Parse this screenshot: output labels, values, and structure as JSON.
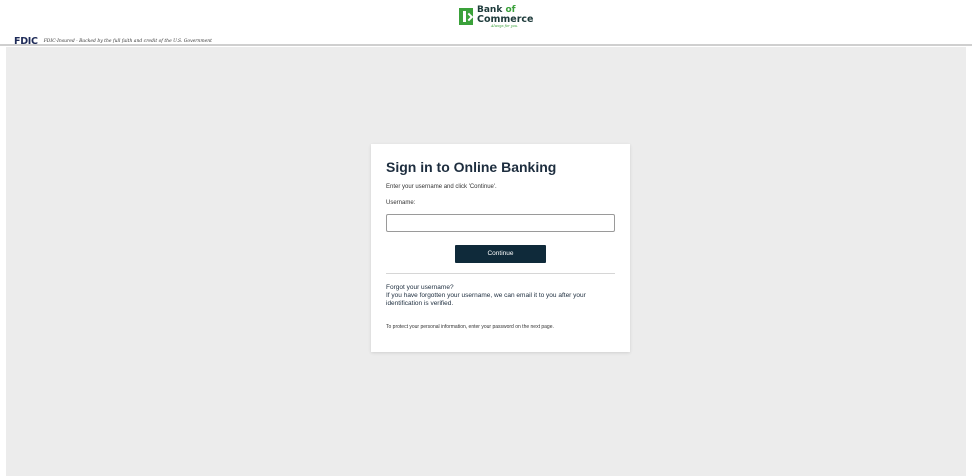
{
  "header": {
    "fdic_logo": "FDIC",
    "fdic_text": "FDIC-Insured - Backed by the full faith and credit of the U.S. Government",
    "brand_line1_a": "Bank",
    "brand_line1_b": "of",
    "brand_line2": "Commerce",
    "brand_tagline": "Always for you.",
    "brand_colors": {
      "green": "#3aa13a",
      "dark": "#1d3a3a"
    }
  },
  "signin": {
    "title": "Sign in to Online Banking",
    "instructions": "Enter your username and click 'Continue'.",
    "username_label": "Username:",
    "username_value": "",
    "continue_label": "Continue",
    "forgot_link": "Forgot your username?",
    "forgot_text": "If you have forgotten your username, we can email it to you after your identification is verified.",
    "protect_text": "To protect your personal information, enter your password on the next page."
  },
  "colors": {
    "button_bg": "#0f2a3a",
    "page_bg": "#ececec"
  }
}
